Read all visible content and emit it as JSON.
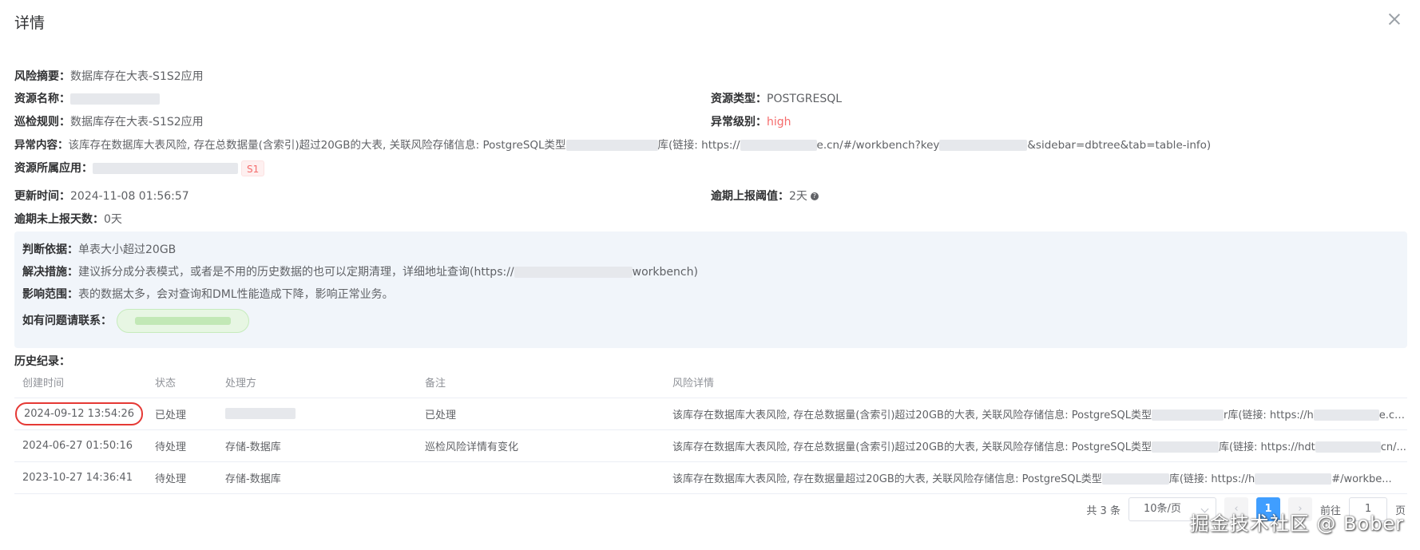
{
  "dialog": {
    "title": "详情"
  },
  "info": {
    "risk_summary_label": "风险摘要：",
    "risk_summary": "数据库存在大表-S1S2应用",
    "resource_name_label": "资源名称：",
    "resource_type_label": "资源类型：",
    "resource_type": "POSTGRESQL",
    "inspection_rule_label": "巡检规则：",
    "inspection_rule": "数据库存在大表-S1S2应用",
    "anomaly_level_label": "异常级别：",
    "anomaly_level": "high",
    "anomaly_content_label": "异常内容：",
    "anomaly_content_a": "该库存在数据库大表风险, 存在总数据量(含索引)超过20GB的大表, 关联风险存储信息: PostgreSQL类型",
    "anomaly_content_b": "库(链接: https://",
    "anomaly_content_c": "e.cn/#/workbench?key",
    "anomaly_content_d": "&sidebar=dbtree&tab=table-info)",
    "owner_app_label": "资源所属应用：",
    "owner_app_tag": "S1",
    "update_time_label": "更新时间：",
    "update_time": "2024-11-08 01:56:57",
    "overdue_threshold_label": "逾期上报阈值：",
    "overdue_threshold": "2天",
    "overdue_days_label": "逾期未上报天数：",
    "overdue_days": "0天"
  },
  "basis": {
    "judgment_label": "判断依据：",
    "judgment": "单表大小超过20GB",
    "solution_label": "解决措施：",
    "solution_a": "建议拆分成分表模式，或者是不用的历史数据的也可以定期清理，详细地址查询(https://",
    "solution_b": "workbench)",
    "impact_label": "影响范围：",
    "impact": "表的数据太多，会对查询和DML性能造成下降，影响正常业务。",
    "contact_label": "如有问题请联系："
  },
  "history": {
    "title": "历史纪录：",
    "columns": [
      "创建时间",
      "状态",
      "处理方",
      "备注",
      "风险详情"
    ],
    "rows": [
      {
        "time": "2024-09-12 13:54:26",
        "status": "已处理",
        "handler": "",
        "note": "已处理",
        "detail": "该库存在数据库大表风险, 存在总数据量(含索引)超过20GB的大表, 关联风险存储信息: PostgreSQL类型",
        "detail_b": "r库(链接: https://h",
        "detail_c": "e.cn/..."
      },
      {
        "time": "2024-06-27 01:50:16",
        "status": "待处理",
        "handler": "存储-数据库",
        "note": "巡检风险详情有变化",
        "detail": "该库存在数据库大表风险, 存在总数据量(含索引)超过20GB的大表, 关联风险存储信息: PostgreSQL类型",
        "detail_b": "库(链接: https://hdt",
        "detail_c": "cn/..."
      },
      {
        "time": "2023-10-27 14:36:41",
        "status": "待处理",
        "handler": "存储-数据库",
        "note": "",
        "detail": "该库存在数据库大表风险, 存在数据量超过20GB的大表, 关联风险存储信息: PostgreSQL类型",
        "detail_b": "库(链接: https://h",
        "detail_c": "#/workbe..."
      }
    ]
  },
  "pagination": {
    "total": "共 3 条",
    "page_size": "10条/页",
    "prev": "‹",
    "current": "1",
    "next": "›",
    "goto_label": "前往",
    "goto_value": "1",
    "page_unit": "页"
  },
  "watermark": "掘金技术社区 @ Bober",
  "colors": {
    "primary": "#409eff",
    "danger": "#f56c6c",
    "highlight_ring": "#e53935"
  }
}
